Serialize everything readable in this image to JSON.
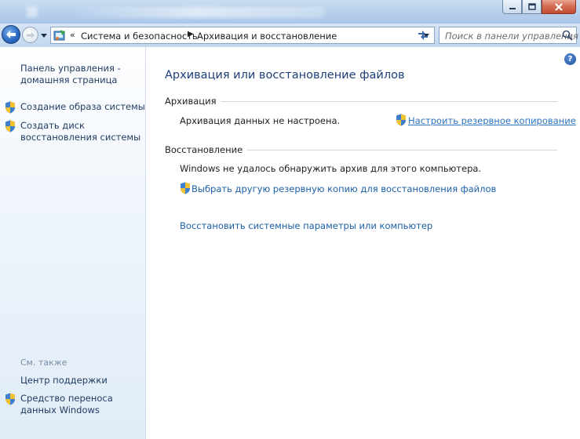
{
  "window": {
    "caption_buttons": {
      "minimize": "minimize",
      "maximize": "maximize",
      "close": "close"
    }
  },
  "navigation": {
    "breadcrumbs": [
      "Система и безопасность",
      "Архивация и восстановление"
    ],
    "search_placeholder": "Поиск в панели управления"
  },
  "sidebar": {
    "home_link": "Панель управления - домашняя страница",
    "tasks": [
      {
        "label": "Создание образа системы",
        "icon": "shield-icon"
      },
      {
        "label": "Создать диск восстановления системы",
        "icon": "shield-icon"
      }
    ],
    "see_also_title": "См. также",
    "see_also": [
      {
        "label": "Центр поддержки"
      },
      {
        "label": "Средство переноса данных Windows",
        "icon": "shield-icon"
      }
    ]
  },
  "main": {
    "help_glyph": "?",
    "title": "Архивация или восстановление файлов",
    "backup": {
      "heading": "Архивация",
      "status": "Архивация данных не настроена.",
      "setup_link": "Настроить резервное копирование"
    },
    "restore": {
      "heading": "Восстановление",
      "status": "Windows не удалось обнаружить архив для этого компьютера.",
      "choose_link": "Выбрать другую резервную копию для восстановления файлов",
      "system_link": "Восстановить системные параметры или компьютер"
    }
  },
  "colors": {
    "link": "#1c5fa8",
    "title": "#1e3f7a",
    "sidebar_text": "#1e3a5f",
    "close_button": "#c24a2f"
  }
}
